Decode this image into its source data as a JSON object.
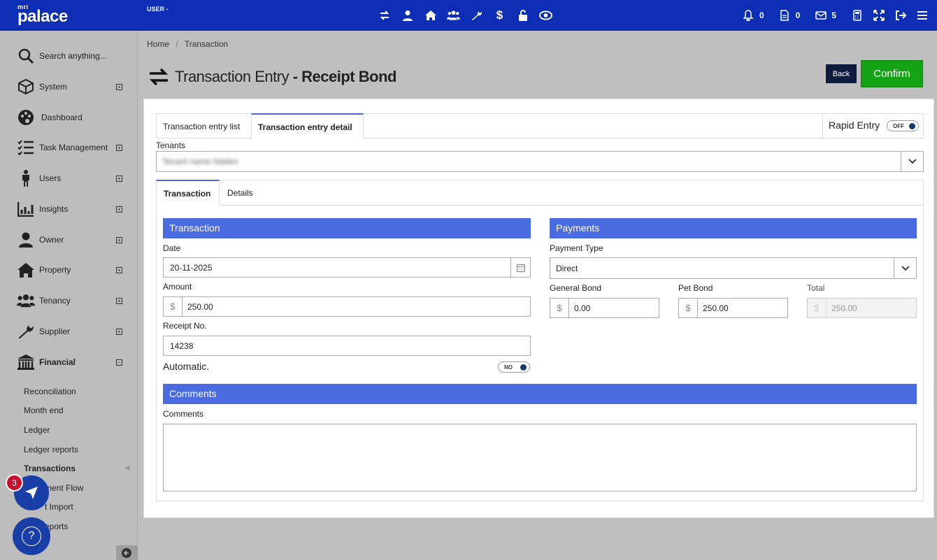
{
  "app": {
    "logo_small": "mri",
    "logo_main": "palace",
    "user_label": "USER -"
  },
  "top_icons": [
    "sync-icon",
    "user-icon",
    "home-icon",
    "users-icon",
    "wrench-icon",
    "dollar-icon",
    "unlock-icon",
    "eye-icon"
  ],
  "notifications": {
    "bell_count": "0",
    "doc_count": "0",
    "mail_count": "5"
  },
  "sidebar": {
    "search_placeholder": "Search anything...",
    "items": [
      {
        "label": "System"
      },
      {
        "label": "Dashboard"
      },
      {
        "label": "Task Management"
      },
      {
        "label": "Users"
      },
      {
        "label": "Insights"
      },
      {
        "label": "Owner"
      },
      {
        "label": "Property"
      },
      {
        "label": "Tenancy"
      },
      {
        "label": "Supplier"
      },
      {
        "label": "Financial"
      }
    ],
    "financial_sub": [
      "Reconciliation",
      "Month end",
      "Ledger",
      "Ledger reports",
      "Transactions",
      "ment Flow",
      "t Import",
      "eports"
    ],
    "support_badge": "3",
    "help_glyph": "?"
  },
  "breadcrumb": {
    "home": "Home",
    "sep": "/",
    "current": "Transaction"
  },
  "page": {
    "title_light": "Transaction Entry",
    "title_bold": "- Receipt Bond",
    "back_label": "Back",
    "confirm_label": "Confirm"
  },
  "tabs": {
    "list": "Transaction entry list",
    "detail": "Transaction entry detail",
    "rapid_entry": "Rapid Entry",
    "rapid_state": "OFF"
  },
  "tenants": {
    "label": "Tenants",
    "value": "Tenant name hidden"
  },
  "subtabs": {
    "transaction": "Transaction",
    "details": "Details"
  },
  "transaction": {
    "header": "Transaction",
    "date_label": "Date",
    "date_value": "20-11-2025",
    "amount_label": "Amount",
    "currency": "$",
    "amount_value": "250.00",
    "receipt_label": "Receipt No.",
    "receipt_value": "14238",
    "automatic_label": "Automatic.",
    "automatic_state": "NO"
  },
  "payments": {
    "header": "Payments",
    "type_label": "Payment Type",
    "type_value": "Direct",
    "general_label": "General Bond",
    "general_value": "0.00",
    "pet_label": "Pet Bond",
    "pet_value": "250.00",
    "total_label": "Total",
    "total_value": "250.00"
  },
  "comments": {
    "header": "Comments",
    "label": "Comments",
    "value": ""
  }
}
